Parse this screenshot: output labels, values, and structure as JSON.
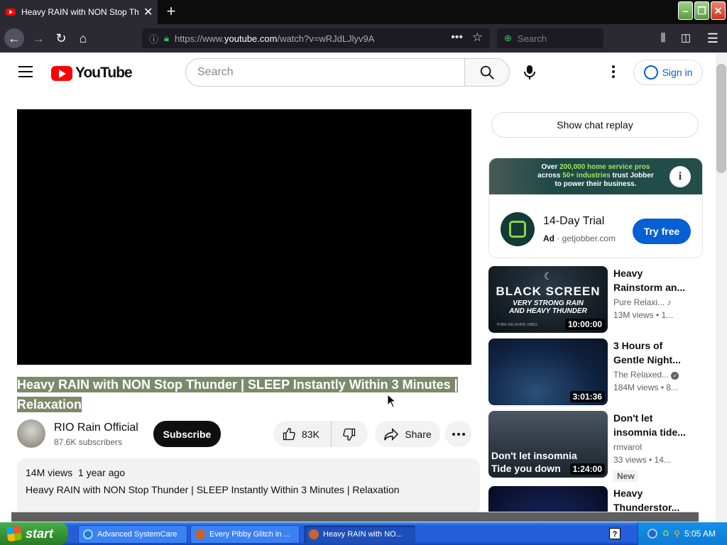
{
  "browser": {
    "tab_title": "Heavy RAIN with NON Stop Thunder",
    "url_prefix": "https://www.",
    "url_domain": "youtube.com",
    "url_path": "/watch?v=wRJdLJlyv9A",
    "search_placeholder": "Search"
  },
  "youtube": {
    "logo_text": "YouTube",
    "search_placeholder": "Search",
    "sign_in": "Sign in",
    "video": {
      "title": "Heavy RAIN with NON Stop Thunder | SLEEP Instantly Within 3 Minutes | Relaxation",
      "channel": "RIO Rain Official",
      "subscribers": "87.6K subscribers",
      "subscribe": "Subscribe",
      "likes": "83K",
      "share": "Share",
      "views": "14M views",
      "age": "1 year ago",
      "description": "Heavy RAIN with NON Stop Thunder | SLEEP Instantly Within 3 Minutes | Relaxation"
    },
    "chat_replay": "Show chat replay",
    "ad": {
      "banner_line1_pre": "Over ",
      "banner_line1_hl": "200,000 home service pros",
      "banner_line2_pre": "across ",
      "banner_line2_hl": "50+ industries",
      "banner_line2_post": " trust Jobber",
      "banner_line3": "to power their business.",
      "title": "14-Day Trial",
      "label": "Ad",
      "domain": "getjobber.com",
      "cta": "Try free"
    },
    "recommendations": [
      {
        "title": "Heavy Rainstorm an...",
        "channel": "Pure Relaxi...",
        "views": "13M views  •  1...",
        "duration": "10:00:00",
        "thumb_line1": "BLACK SCREEN",
        "thumb_line2": "VERY STRONG RAIN",
        "thumb_line3": "AND HEAVY THUNDER",
        "thumb_line4": "PURE RELAXING VIBES"
      },
      {
        "title": "3 Hours of Gentle Night...",
        "channel": "The Relaxed...",
        "views": "184M views  •  8...",
        "duration": "3:01:36"
      },
      {
        "title": "Don't let insomnia tide...",
        "channel": "rmvarol",
        "views": "33 views  •  14...",
        "duration": "1:24:00",
        "badge": "New",
        "thumb_line1": "Don't let insomnia",
        "thumb_line2": "Tide you down"
      },
      {
        "title": "Heavy Thunderstor..."
      }
    ]
  },
  "taskbar": {
    "start": "start",
    "items": [
      {
        "label": "Advanced SystemCare"
      },
      {
        "label": "Every Pibby Glitch in ..."
      },
      {
        "label": "Heavy RAIN with NO..."
      }
    ],
    "help": "?",
    "clock": "5:05 AM"
  }
}
